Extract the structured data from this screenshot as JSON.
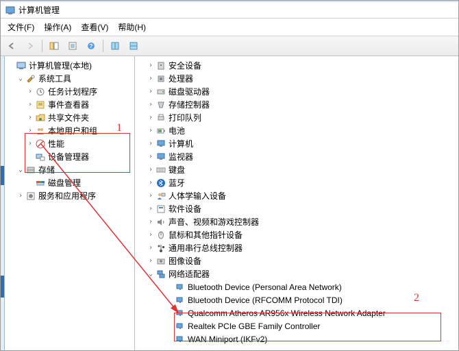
{
  "window": {
    "title": "计算机管理"
  },
  "menubar": [
    "文件(F)",
    "操作(A)",
    "查看(V)",
    "帮助(H)"
  ],
  "leftTree": {
    "root": "计算机管理(本地)",
    "groups": [
      {
        "label": "系统工具",
        "expanded": true,
        "children": [
          {
            "label": "任务计划程序",
            "icon": "sched"
          },
          {
            "label": "事件查看器",
            "icon": "events"
          },
          {
            "label": "共享文件夹",
            "icon": "shares"
          },
          {
            "label": "本地用户和组",
            "icon": "users"
          },
          {
            "label": "性能",
            "icon": "perf"
          },
          {
            "label": "设备管理器",
            "icon": "devmgr"
          }
        ]
      },
      {
        "label": "存储",
        "expanded": true,
        "children": [
          {
            "label": "磁盘管理",
            "icon": "disk"
          }
        ]
      },
      {
        "label": "服务和应用程序",
        "expanded": false,
        "children": []
      }
    ]
  },
  "rightTree": {
    "categories": [
      {
        "label": "安全设备",
        "icon": "security"
      },
      {
        "label": "处理器",
        "icon": "cpu"
      },
      {
        "label": "磁盘驱动器",
        "icon": "drive"
      },
      {
        "label": "存储控制器",
        "icon": "storage"
      },
      {
        "label": "打印队列",
        "icon": "printer"
      },
      {
        "label": "电池",
        "icon": "battery"
      },
      {
        "label": "计算机",
        "icon": "computer"
      },
      {
        "label": "监视器",
        "icon": "monitor"
      },
      {
        "label": "键盘",
        "icon": "keyboard"
      },
      {
        "label": "蓝牙",
        "icon": "bluetooth"
      },
      {
        "label": "人体学输入设备",
        "icon": "hid"
      },
      {
        "label": "软件设备",
        "icon": "software"
      },
      {
        "label": "声音、视频和游戏控制器",
        "icon": "sound"
      },
      {
        "label": "鼠标和其他指针设备",
        "icon": "mouse"
      },
      {
        "label": "通用串行总线控制器",
        "icon": "usb"
      },
      {
        "label": "图像设备",
        "icon": "imaging"
      }
    ],
    "network": {
      "label": "网络适配器",
      "devices": [
        "Bluetooth Device (Personal Area Network)",
        "Bluetooth Device (RFCOMM Protocol TDI)",
        "Qualcomm Atheros AR956x Wireless Network Adapter",
        "Realtek PCIe GBE Family Controller",
        "WAN Miniport (IKFv2)"
      ]
    }
  },
  "annotations": {
    "label1": "1",
    "label2": "2"
  }
}
